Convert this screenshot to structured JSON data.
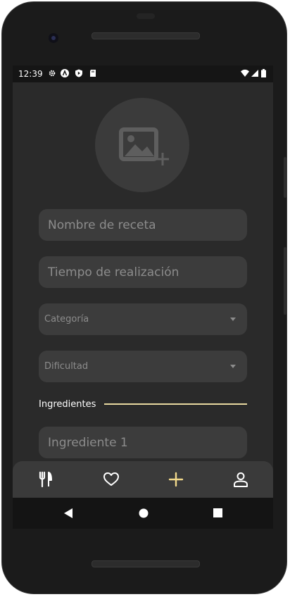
{
  "status_bar": {
    "time": "12:39",
    "left_icons": [
      "settings-icon",
      "a-badge-icon",
      "shield-play-icon",
      "sd-card-icon"
    ],
    "right_icons": [
      "wifi-icon",
      "signal-icon",
      "battery-icon"
    ]
  },
  "form": {
    "image_picker_icon": "add-photo-icon",
    "recipe_name_placeholder": "Nombre de receta",
    "prep_time_placeholder": "Tiempo de realización",
    "category_label": "Categoría",
    "difficulty_label": "Dificultad",
    "ingredients_section_label": "Ingredientes",
    "ingredient_1_placeholder": "Ingrediente 1"
  },
  "bottom_nav": {
    "items": [
      {
        "icon": "fork-knife-icon",
        "active": false
      },
      {
        "icon": "heart-icon",
        "active": false
      },
      {
        "icon": "plus-icon",
        "active": true
      },
      {
        "icon": "user-icon",
        "active": false
      }
    ]
  },
  "system_nav": [
    "back-icon",
    "home-icon",
    "recents-icon"
  ],
  "colors": {
    "background": "#2a2a2a",
    "field": "#3c3c3c",
    "accent": "#f2d98b",
    "placeholder": "#8c8c8c"
  }
}
